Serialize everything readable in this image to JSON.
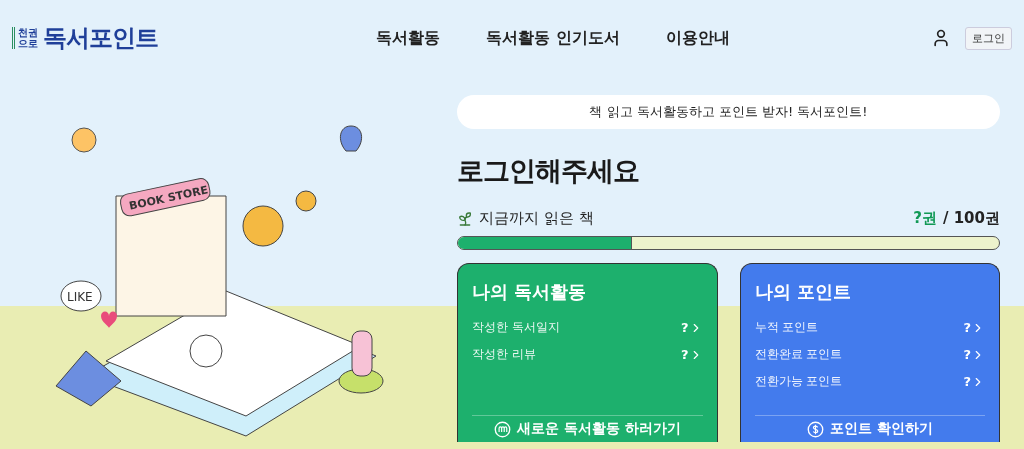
{
  "header": {
    "logo": {
      "badge": "천권으로",
      "title": "독서포인트"
    },
    "nav": [
      {
        "label": "독서활동"
      },
      {
        "label": "독서활동 인기도서"
      },
      {
        "label": "이용안내"
      }
    ],
    "login_button": "로그인"
  },
  "illustration": {
    "sign": "BOOK STORE",
    "bubble": "LIKE"
  },
  "banner": "책 읽고 독서활동하고 포인트 받자! 독서포인트!",
  "heading": "로그인해주세요",
  "progress": {
    "label": "지금까지 읽은 책",
    "count": "?권",
    "total": "/ 100권",
    "level": 0.32
  },
  "cards": [
    {
      "title": "나의 독서활동",
      "color": "#1db06d",
      "rows": [
        {
          "label": "작성한 독서일지",
          "value": "?"
        },
        {
          "label": "작성한 리뷰",
          "value": "?"
        }
      ],
      "action": {
        "kind": "activity",
        "label": "새로운 독서활동 하러가기"
      }
    },
    {
      "title": "나의 포인트",
      "color": "#437bed",
      "rows": [
        {
          "label": "누적 포인트",
          "value": "?"
        },
        {
          "label": "전환완료 포인트",
          "value": "?"
        },
        {
          "label": "전환가능 포인트",
          "value": "?"
        }
      ],
      "action": {
        "kind": "points",
        "label": "포인트 확인하기"
      }
    }
  ]
}
